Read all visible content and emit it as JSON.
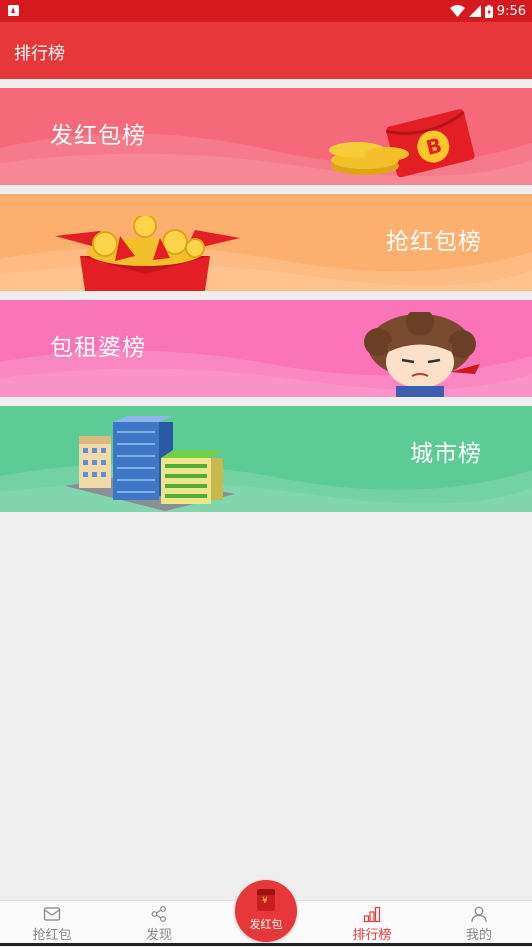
{
  "status_bar": {
    "time": "9:56"
  },
  "app_bar": {
    "title": "排行榜"
  },
  "cards": [
    {
      "label": "发红包榜",
      "image": "red-envelope-bitcoin-coins",
      "color": "#f5697a"
    },
    {
      "label": "抢红包榜",
      "image": "open-red-envelope-coins",
      "color": "#fdb06e"
    },
    {
      "label": "包租婆榜",
      "image": "cartoon-landlady",
      "color": "#fb74b8"
    },
    {
      "label": "城市榜",
      "image": "city-buildings",
      "color": "#5ccb95"
    }
  ],
  "bottom_nav": {
    "items": [
      {
        "label": "抢红包",
        "icon": "envelope-icon"
      },
      {
        "label": "发现",
        "icon": "share-icon"
      },
      {
        "label": "发红包",
        "icon": "red-envelope-icon"
      },
      {
        "label": "排行榜",
        "icon": "bar-chart-icon",
        "active": true
      },
      {
        "label": "我的",
        "icon": "person-icon"
      }
    ]
  },
  "colors": {
    "primary": "#e8373a",
    "status_bar": "#d41a1e"
  }
}
